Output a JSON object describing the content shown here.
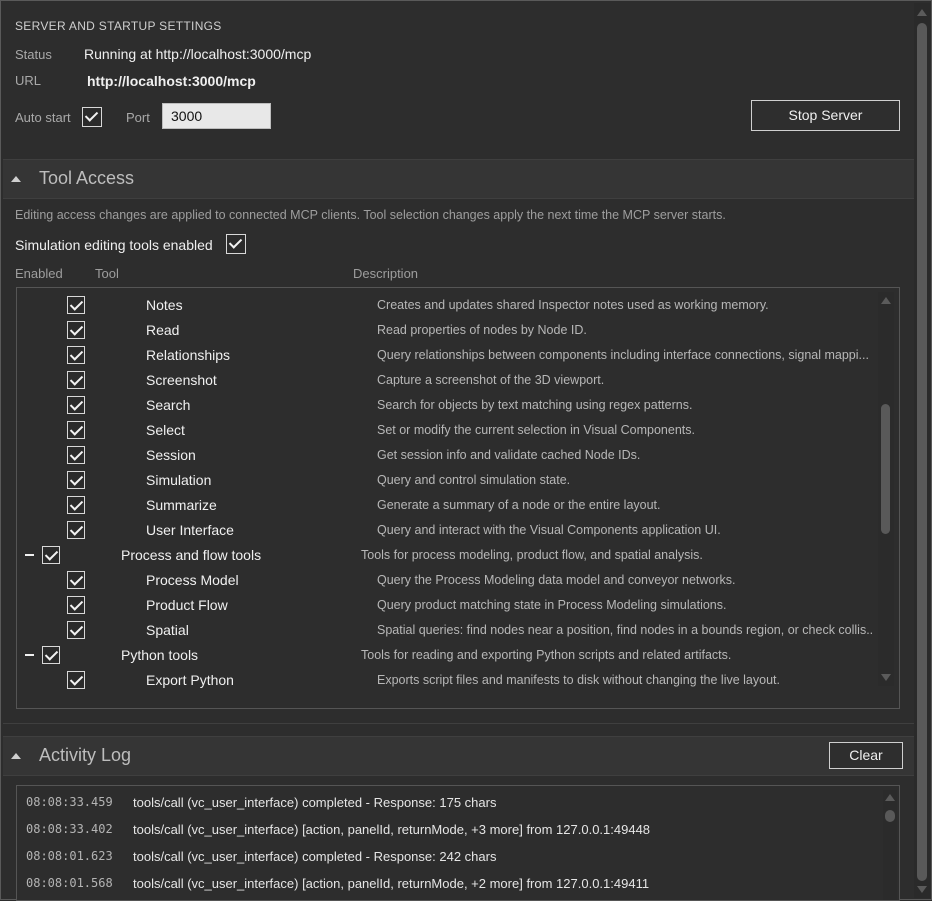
{
  "server": {
    "section_title": "SERVER AND STARTUP SETTINGS",
    "status_label": "Status",
    "status_value": "Running at http://localhost:3000/mcp",
    "url_label": "URL",
    "url_value": "http://localhost:3000/mcp",
    "auto_start_label": "Auto start",
    "auto_start_checked": true,
    "port_label": "Port",
    "port_value": "3000",
    "stop_button": "Stop Server"
  },
  "tool_access": {
    "title": "Tool Access",
    "info": "Editing access changes are applied to connected MCP clients. Tool selection changes apply the next time the MCP server starts.",
    "sim_editing_label": "Simulation editing tools enabled",
    "sim_editing_checked": true,
    "columns": {
      "enabled": "Enabled",
      "tool": "Tool",
      "description": "Description"
    },
    "rows": [
      {
        "kind": "tool",
        "name": "Notes",
        "description": "Creates and updates shared Inspector notes used as working memory.",
        "checked": true
      },
      {
        "kind": "tool",
        "name": "Read",
        "description": "Read properties of nodes by Node ID.",
        "checked": true
      },
      {
        "kind": "tool",
        "name": "Relationships",
        "description": "Query relationships between components including interface connections, signal mappi...",
        "checked": true
      },
      {
        "kind": "tool",
        "name": "Screenshot",
        "description": "Capture a screenshot of the 3D viewport.",
        "checked": true
      },
      {
        "kind": "tool",
        "name": "Search",
        "description": "Search for objects by text matching using regex patterns.",
        "checked": true
      },
      {
        "kind": "tool",
        "name": "Select",
        "description": "Set or modify the current selection in Visual Components.",
        "checked": true
      },
      {
        "kind": "tool",
        "name": "Session",
        "description": "Get session info and validate cached Node IDs.",
        "checked": true
      },
      {
        "kind": "tool",
        "name": "Simulation",
        "description": "Query and control simulation state.",
        "checked": true
      },
      {
        "kind": "tool",
        "name": "Summarize",
        "description": "Generate a summary of a node or the entire layout.",
        "checked": true
      },
      {
        "kind": "tool",
        "name": "User Interface",
        "description": "Query and interact with the Visual Components application UI.",
        "checked": true
      },
      {
        "kind": "group",
        "name": "Process and flow tools",
        "description": "Tools for process modeling, product flow, and spatial analysis.",
        "checked": true
      },
      {
        "kind": "tool",
        "name": "Process Model",
        "description": "Query the Process Modeling data model and conveyor networks.",
        "checked": true
      },
      {
        "kind": "tool",
        "name": "Product Flow",
        "description": "Query product matching state in Process Modeling simulations.",
        "checked": true
      },
      {
        "kind": "tool",
        "name": "Spatial",
        "description": "Spatial queries: find nodes near a position, find nodes in a bounds region, or check collis...",
        "checked": true
      },
      {
        "kind": "group",
        "name": "Python tools",
        "description": "Tools for reading and exporting Python scripts and related artifacts.",
        "checked": true
      },
      {
        "kind": "tool",
        "name": "Export Python",
        "description": "Exports script files and manifests to disk without changing the live layout.",
        "checked": true
      }
    ]
  },
  "activity_log": {
    "title": "Activity Log",
    "clear_button": "Clear",
    "entries": [
      {
        "time": "08:08:33.459",
        "message": "tools/call (vc_user_interface) completed - Response: 175 chars"
      },
      {
        "time": "08:08:33.402",
        "message": "tools/call (vc_user_interface) [action, panelId, returnMode, +3 more] from 127.0.0.1:49448"
      },
      {
        "time": "08:08:01.623",
        "message": "tools/call (vc_user_interface) completed - Response: 242 chars"
      },
      {
        "time": "08:08:01.568",
        "message": "tools/call (vc_user_interface) [action, panelId, returnMode, +2 more] from 127.0.0.1:49411"
      }
    ]
  },
  "colors": {
    "background": "#2d2d2d",
    "header": "#353535",
    "border": "#555555",
    "text": "#e6e6e6",
    "muted": "#a9a9a9"
  }
}
